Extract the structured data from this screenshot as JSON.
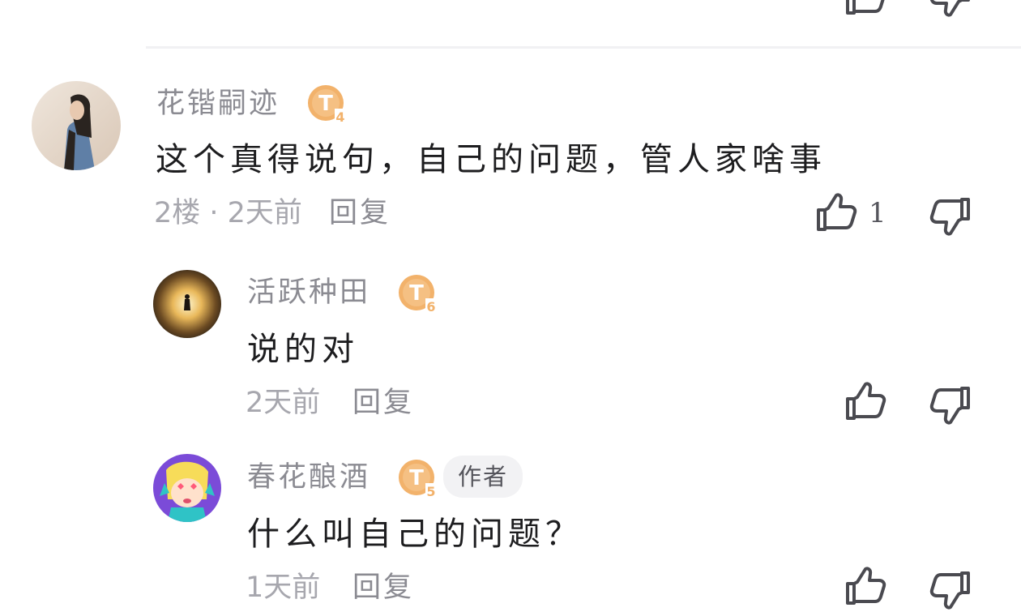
{
  "colors": {
    "badge": "#f2b26b",
    "badge_dark": "#e09a4d",
    "icon": "#4a4a50",
    "name": "#8b8b92",
    "meta": "#a7a7ae"
  },
  "comments": [
    {
      "username": "花锴嗣迹",
      "level_badge": "T",
      "level_number": "4",
      "content": "这个真得说句，自己的问题，管人家啥事",
      "meta": "2楼 · 2天前",
      "reply_label": "回复",
      "likes": "1",
      "like_icon": "thumbs-up-icon",
      "dislike_icon": "thumbs-down-icon"
    },
    {
      "username": "活跃种田",
      "level_badge": "T",
      "level_number": "6",
      "content": "说的对",
      "meta": "2天前",
      "reply_label": "回复",
      "like_icon": "thumbs-up-icon",
      "dislike_icon": "thumbs-down-icon"
    },
    {
      "username": "春花酿酒",
      "level_badge": "T",
      "level_number": "5",
      "author_tag": "作者",
      "content": "什么叫自己的问题？",
      "meta": "1天前",
      "reply_label": "回复",
      "like_icon": "thumbs-up-icon",
      "dislike_icon": "thumbs-down-icon"
    }
  ]
}
